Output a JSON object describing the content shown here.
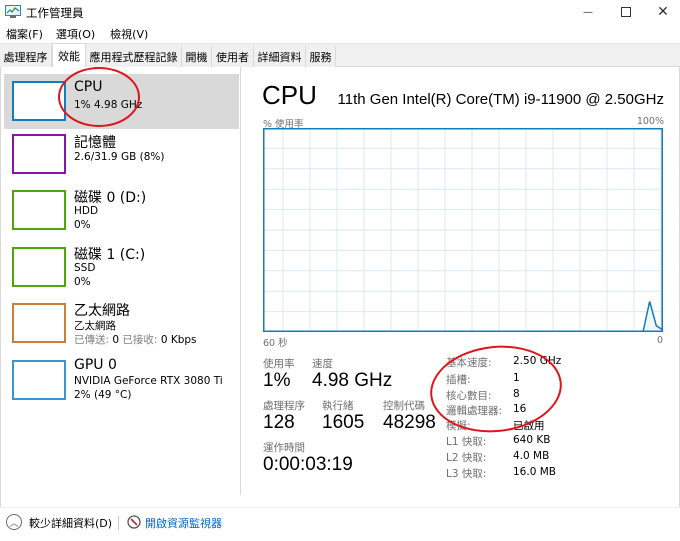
{
  "window": {
    "title": "工作管理員",
    "icons": {
      "app": "task-manager-icon",
      "minimize": "minimize-icon",
      "maximize": "maximize-icon",
      "close": "close-icon"
    },
    "minimize_glyph": "—",
    "maximize_glyph": "☐",
    "close_glyph": "✕"
  },
  "menu": [
    {
      "label": "檔案(F)"
    },
    {
      "label": "選項(O)"
    },
    {
      "label": "檢視(V)"
    }
  ],
  "tabs": [
    {
      "label": "處理程序",
      "active": false
    },
    {
      "label": "效能",
      "active": true
    },
    {
      "label": "應用程式歷程記錄",
      "active": false
    },
    {
      "label": "開機",
      "active": false
    },
    {
      "label": "使用者",
      "active": false
    },
    {
      "label": "詳細資料",
      "active": false
    },
    {
      "label": "服務",
      "active": false
    }
  ],
  "sidebar": {
    "items": [
      {
        "name": "CPU",
        "line1": "1% 4.98 GHz",
        "line2": "",
        "line3": "",
        "color": "#117dbb",
        "selected": true
      },
      {
        "name": "記憶體",
        "line1": "2.6/31.9 GB (8%)",
        "line2": "",
        "line3": "",
        "color": "#8b12ae",
        "selected": false
      },
      {
        "name": "磁碟 0 (D:)",
        "line1": "HDD",
        "line2": "0%",
        "line3": "",
        "color": "#4da60c",
        "selected": false
      },
      {
        "name": "磁碟 1 (C:)",
        "line1": "SSD",
        "line2": "0%",
        "line3": "",
        "color": "#4da60c",
        "selected": false
      },
      {
        "name": "乙太網路",
        "line1": "乙太網路",
        "line2_send_label": "已傳送:",
        "line2_send_value": "0",
        "line2_recv_label": "已接收:",
        "line2_recv_value": "0 Kbps",
        "color": "#a74f01",
        "selected": false
      },
      {
        "name": "GPU 0",
        "line1": "NVIDIA GeForce RTX 3080 Ti",
        "line2": "2% (49 °C)",
        "line3": "",
        "color": "#117dbb",
        "selected": false
      }
    ]
  },
  "main": {
    "title": "CPU",
    "model": "11th Gen Intel(R) Core(TM) i9-11900 @ 2.50GHz",
    "chart_label_top_left": "% 使用率",
    "chart_label_top_right": "100%",
    "chart_label_bottom_left": "60 秒",
    "chart_label_bottom_right": "0",
    "stats": {
      "usage_label": "使用率",
      "usage_value": "1%",
      "speed_label": "速度",
      "speed_value": "4.98 GHz",
      "processes_label": "處理程序",
      "processes_value": "128",
      "threads_label": "執行緒",
      "threads_value": "1605",
      "handles_label": "控制代碼",
      "handles_value": "48298",
      "uptime_label": "運作時間",
      "uptime_value": "0:00:03:19"
    },
    "info": [
      {
        "key": "基本速度:",
        "value": "2.50 GHz"
      },
      {
        "key": "插槽:",
        "value": "1"
      },
      {
        "key": "核心數目:",
        "value": "8"
      },
      {
        "key": "邏輯處理器:",
        "value": "16"
      },
      {
        "key": "模擬:",
        "value": "已啟用"
      },
      {
        "key": "L1 快取:",
        "value": "640 KB"
      },
      {
        "key": "L2 快取:",
        "value": "4.0 MB"
      },
      {
        "key": "L3 快取:",
        "value": "16.0 MB"
      }
    ]
  },
  "cpu_history": {
    "unit": "percent",
    "window_seconds": 60,
    "values_recent_last": [
      0,
      0,
      0,
      0,
      0,
      0,
      0,
      0,
      0,
      0,
      0,
      0,
      0,
      0,
      0,
      0,
      0,
      0,
      0,
      0,
      0,
      0,
      0,
      0,
      0,
      0,
      0,
      0,
      0,
      0,
      0,
      0,
      0,
      0,
      0,
      0,
      0,
      0,
      0,
      0,
      0,
      0,
      0,
      0,
      0,
      0,
      0,
      0,
      0,
      0,
      0,
      0,
      0,
      0,
      0,
      0,
      0,
      0,
      15,
      3,
      1
    ]
  },
  "accent_colors": {
    "cpu": "#117dbb",
    "memory": "#8b12ae",
    "disk": "#4da60c",
    "ethernet": "#a74f01",
    "gpu": "#117dbb",
    "annotation": "#e0141c",
    "link": "#0066cc"
  },
  "footer": {
    "fewer_details": "較少詳細資料(D)",
    "open_resource_monitor": "開啟資源監視器"
  }
}
